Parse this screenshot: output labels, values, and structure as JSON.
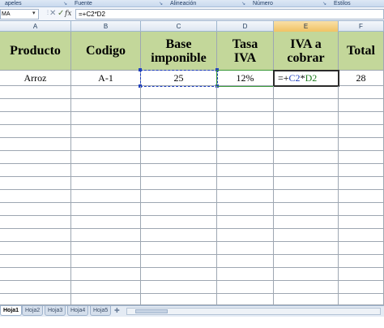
{
  "ribbon": {
    "groups": [
      {
        "label": "apeles",
        "width": 86
      },
      {
        "label": "Fuente",
        "width": 118
      },
      {
        "label": "Alineación",
        "width": 102
      },
      {
        "label": "Número",
        "width": 100
      },
      {
        "label": "Estilos",
        "width": 68
      }
    ]
  },
  "formula_bar": {
    "name_box": "MA",
    "formula": "=+C2*D2"
  },
  "columns": [
    "A",
    "B",
    "C",
    "D",
    "E",
    "F"
  ],
  "active_column": "E",
  "table": {
    "headers": [
      "Producto",
      "Codigo",
      "Base imponible",
      "Tasa IVA",
      "IVA a cobrar",
      "Total"
    ],
    "row": {
      "producto": "Arroz",
      "codigo": "A-1",
      "base": "25",
      "tasa": "12%",
      "formula_prefix": "=+",
      "ref1": "C2",
      "op": "*",
      "ref2": "D2",
      "total": "28"
    }
  },
  "sheets": [
    {
      "label": "Hoja1",
      "active": true
    },
    {
      "label": "Hoja2",
      "active": false
    },
    {
      "label": "Hoja3",
      "active": false
    },
    {
      "label": "Hoja4",
      "active": false
    },
    {
      "label": "Hoja5",
      "active": false
    }
  ],
  "colors": {
    "header_fill": "#c3d79a",
    "ref_c2": "#1f3fbf",
    "ref_d2": "#1c7a1c",
    "active_col_header": "#f1c264"
  }
}
